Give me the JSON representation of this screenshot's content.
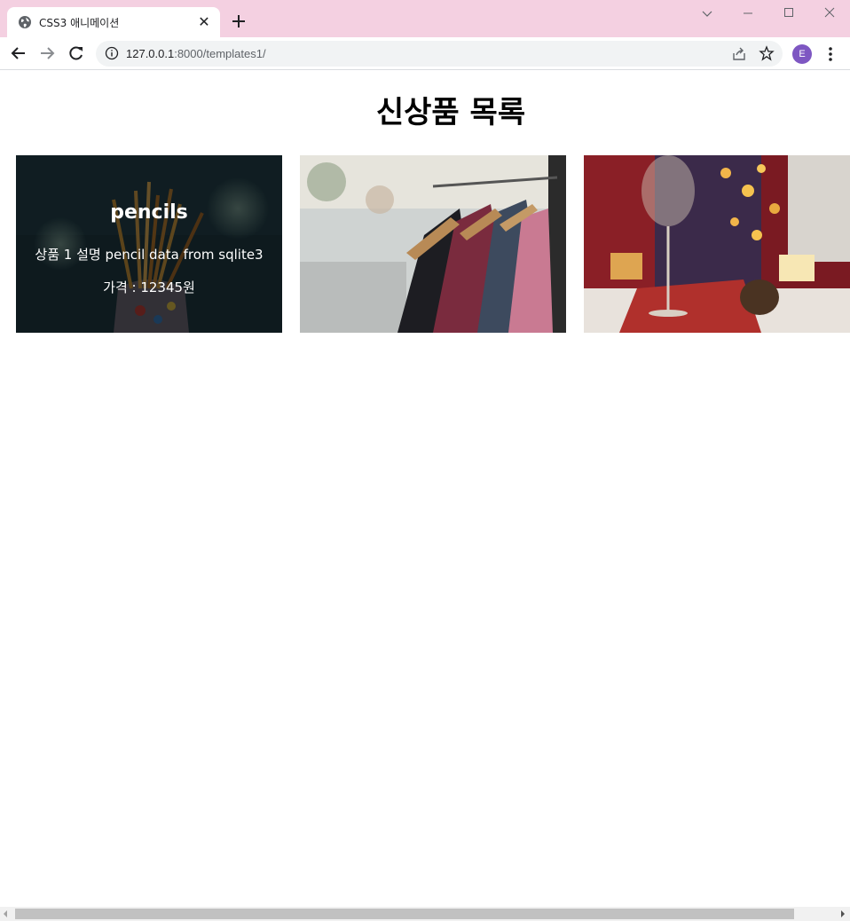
{
  "browser": {
    "tab_title": "CSS3 애니메이션",
    "tab_close": "✕",
    "url_host": "127.0.0.1",
    "url_rest": ":8000/templates1/",
    "profile_initial": "E"
  },
  "page": {
    "heading": "신상품 목록",
    "products": [
      {
        "name": "pencils",
        "description": "상품 1 설명 pencil data from sqlite3",
        "price": "가격 : 12345원"
      }
    ]
  }
}
